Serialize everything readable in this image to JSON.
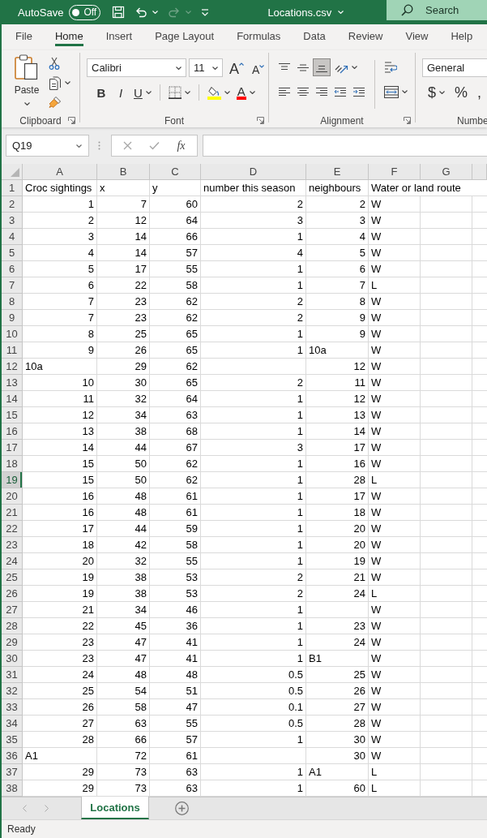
{
  "title_bar": {
    "autosave": {
      "label": "AutoSave",
      "on": false,
      "state": "Off"
    },
    "quick_access": [
      {
        "kind": "save",
        "disabled": false
      },
      {
        "kind": "undo",
        "disabled": false
      },
      {
        "kind": "redo",
        "disabled": true
      },
      {
        "kind": "customize",
        "disabled": false
      }
    ],
    "file_name": "Locations.csv",
    "search": {
      "placeholder": "Search"
    }
  },
  "ribbon_tabs": [
    {
      "label": "File",
      "selected": false
    },
    {
      "label": "Home",
      "selected": true
    },
    {
      "label": "Insert",
      "selected": false
    },
    {
      "label": "Page Layout",
      "selected": false
    },
    {
      "label": "Formulas",
      "selected": false
    },
    {
      "label": "Data",
      "selected": false
    },
    {
      "label": "Review",
      "selected": false
    },
    {
      "label": "View",
      "selected": false
    },
    {
      "label": "Help",
      "selected": false
    }
  ],
  "ribbon": {
    "groups": [
      {
        "kind": "clipboard",
        "label": "Clipboard",
        "paste_label": "Paste"
      },
      {
        "kind": "font",
        "label": "Font",
        "font_name": "Calibri",
        "font_size": "11",
        "grow_label": "A",
        "shrink_label": "A",
        "bold_label": "B",
        "italic_label": "I",
        "underline_label": "U",
        "font_color_label": "A"
      },
      {
        "kind": "alignment",
        "label": "Alignment",
        "vertical_align": [
          {
            "kind": "top",
            "selected": false
          },
          {
            "kind": "middle",
            "selected": false
          },
          {
            "kind": "bottom",
            "selected": true
          }
        ]
      },
      {
        "kind": "number",
        "label": "Numbe",
        "format": "General",
        "currency_label": "$",
        "percent_label": "%",
        "comma_label": ","
      }
    ]
  },
  "formula_bar": {
    "name_box": "Q19",
    "function_label": "fx"
  },
  "sheet": {
    "columns": [
      "A",
      "B",
      "C",
      "D",
      "E",
      "F",
      "G"
    ],
    "rows": [
      {
        "number": "1",
        "selected": false,
        "cells": [
          {
            "text": "Croc sightings",
            "kind": "text"
          },
          {
            "text": "x",
            "kind": "text"
          },
          {
            "text": "y",
            "kind": "text"
          },
          {
            "text": "number this season",
            "kind": "text"
          },
          {
            "text": "neighbours",
            "kind": "text"
          },
          {
            "text": "Water or land route",
            "kind": "text"
          }
        ]
      },
      {
        "number": "2",
        "selected": false,
        "cells": [
          {
            "text": "1",
            "kind": "number"
          },
          {
            "text": "7",
            "kind": "number"
          },
          {
            "text": "60",
            "kind": "number"
          },
          {
            "text": "2",
            "kind": "number"
          },
          {
            "text": "2",
            "kind": "number"
          },
          {
            "text": "W",
            "kind": "text"
          }
        ]
      },
      {
        "number": "3",
        "selected": false,
        "cells": [
          {
            "text": "2",
            "kind": "number"
          },
          {
            "text": "12",
            "kind": "number"
          },
          {
            "text": "64",
            "kind": "number"
          },
          {
            "text": "3",
            "kind": "number"
          },
          {
            "text": "3",
            "kind": "number"
          },
          {
            "text": "W",
            "kind": "text"
          }
        ]
      },
      {
        "number": "4",
        "selected": false,
        "cells": [
          {
            "text": "3",
            "kind": "number"
          },
          {
            "text": "14",
            "kind": "number"
          },
          {
            "text": "66",
            "kind": "number"
          },
          {
            "text": "1",
            "kind": "number"
          },
          {
            "text": "4",
            "kind": "number"
          },
          {
            "text": "W",
            "kind": "text"
          }
        ]
      },
      {
        "number": "5",
        "selected": false,
        "cells": [
          {
            "text": "4",
            "kind": "number"
          },
          {
            "text": "14",
            "kind": "number"
          },
          {
            "text": "57",
            "kind": "number"
          },
          {
            "text": "4",
            "kind": "number"
          },
          {
            "text": "5",
            "kind": "number"
          },
          {
            "text": "W",
            "kind": "text"
          }
        ]
      },
      {
        "number": "6",
        "selected": false,
        "cells": [
          {
            "text": "5",
            "kind": "number"
          },
          {
            "text": "17",
            "kind": "number"
          },
          {
            "text": "55",
            "kind": "number"
          },
          {
            "text": "1",
            "kind": "number"
          },
          {
            "text": "6",
            "kind": "number"
          },
          {
            "text": "W",
            "kind": "text"
          }
        ]
      },
      {
        "number": "7",
        "selected": false,
        "cells": [
          {
            "text": "6",
            "kind": "number"
          },
          {
            "text": "22",
            "kind": "number"
          },
          {
            "text": "58",
            "kind": "number"
          },
          {
            "text": "1",
            "kind": "number"
          },
          {
            "text": "7",
            "kind": "number"
          },
          {
            "text": "L",
            "kind": "text"
          }
        ]
      },
      {
        "number": "8",
        "selected": false,
        "cells": [
          {
            "text": "7",
            "kind": "number"
          },
          {
            "text": "23",
            "kind": "number"
          },
          {
            "text": "62",
            "kind": "number"
          },
          {
            "text": "2",
            "kind": "number"
          },
          {
            "text": "8",
            "kind": "number"
          },
          {
            "text": "W",
            "kind": "text"
          }
        ]
      },
      {
        "number": "9",
        "selected": false,
        "cells": [
          {
            "text": "7",
            "kind": "number"
          },
          {
            "text": "23",
            "kind": "number"
          },
          {
            "text": "62",
            "kind": "number"
          },
          {
            "text": "2",
            "kind": "number"
          },
          {
            "text": "9",
            "kind": "number"
          },
          {
            "text": "W",
            "kind": "text"
          }
        ]
      },
      {
        "number": "10",
        "selected": false,
        "cells": [
          {
            "text": "8",
            "kind": "number"
          },
          {
            "text": "25",
            "kind": "number"
          },
          {
            "text": "65",
            "kind": "number"
          },
          {
            "text": "1",
            "kind": "number"
          },
          {
            "text": "9",
            "kind": "number"
          },
          {
            "text": "W",
            "kind": "text"
          }
        ]
      },
      {
        "number": "11",
        "selected": false,
        "cells": [
          {
            "text": "9",
            "kind": "number"
          },
          {
            "text": "26",
            "kind": "number"
          },
          {
            "text": "65",
            "kind": "number"
          },
          {
            "text": "1",
            "kind": "number"
          },
          {
            "text": "10a",
            "kind": "text"
          },
          {
            "text": "W",
            "kind": "text"
          }
        ]
      },
      {
        "number": "12",
        "selected": false,
        "cells": [
          {
            "text": "10a",
            "kind": "text"
          },
          {
            "text": "29",
            "kind": "number"
          },
          {
            "text": "62",
            "kind": "number"
          },
          null,
          {
            "text": "12",
            "kind": "number"
          },
          {
            "text": "W",
            "kind": "text"
          }
        ]
      },
      {
        "number": "13",
        "selected": false,
        "cells": [
          {
            "text": "10",
            "kind": "number"
          },
          {
            "text": "30",
            "kind": "number"
          },
          {
            "text": "65",
            "kind": "number"
          },
          {
            "text": "2",
            "kind": "number"
          },
          {
            "text": "11",
            "kind": "number"
          },
          {
            "text": "W",
            "kind": "text"
          }
        ]
      },
      {
        "number": "14",
        "selected": false,
        "cells": [
          {
            "text": "11",
            "kind": "number"
          },
          {
            "text": "32",
            "kind": "number"
          },
          {
            "text": "64",
            "kind": "number"
          },
          {
            "text": "1",
            "kind": "number"
          },
          {
            "text": "12",
            "kind": "number"
          },
          {
            "text": "W",
            "kind": "text"
          }
        ]
      },
      {
        "number": "15",
        "selected": false,
        "cells": [
          {
            "text": "12",
            "kind": "number"
          },
          {
            "text": "34",
            "kind": "number"
          },
          {
            "text": "63",
            "kind": "number"
          },
          {
            "text": "1",
            "kind": "number"
          },
          {
            "text": "13",
            "kind": "number"
          },
          {
            "text": "W",
            "kind": "text"
          }
        ]
      },
      {
        "number": "16",
        "selected": false,
        "cells": [
          {
            "text": "13",
            "kind": "number"
          },
          {
            "text": "38",
            "kind": "number"
          },
          {
            "text": "68",
            "kind": "number"
          },
          {
            "text": "1",
            "kind": "number"
          },
          {
            "text": "14",
            "kind": "number"
          },
          {
            "text": "W",
            "kind": "text"
          }
        ]
      },
      {
        "number": "17",
        "selected": false,
        "cells": [
          {
            "text": "14",
            "kind": "number"
          },
          {
            "text": "44",
            "kind": "number"
          },
          {
            "text": "67",
            "kind": "number"
          },
          {
            "text": "3",
            "kind": "number"
          },
          {
            "text": "17",
            "kind": "number"
          },
          {
            "text": "W",
            "kind": "text"
          }
        ]
      },
      {
        "number": "18",
        "selected": false,
        "cells": [
          {
            "text": "15",
            "kind": "number"
          },
          {
            "text": "50",
            "kind": "number"
          },
          {
            "text": "62",
            "kind": "number"
          },
          {
            "text": "1",
            "kind": "number"
          },
          {
            "text": "16",
            "kind": "number"
          },
          {
            "text": "W",
            "kind": "text"
          }
        ]
      },
      {
        "number": "19",
        "selected": true,
        "cells": [
          {
            "text": "15",
            "kind": "number"
          },
          {
            "text": "50",
            "kind": "number"
          },
          {
            "text": "62",
            "kind": "number"
          },
          {
            "text": "1",
            "kind": "number"
          },
          {
            "text": "28",
            "kind": "number"
          },
          {
            "text": "L",
            "kind": "text"
          }
        ]
      },
      {
        "number": "20",
        "selected": false,
        "cells": [
          {
            "text": "16",
            "kind": "number"
          },
          {
            "text": "48",
            "kind": "number"
          },
          {
            "text": "61",
            "kind": "number"
          },
          {
            "text": "1",
            "kind": "number"
          },
          {
            "text": "17",
            "kind": "number"
          },
          {
            "text": "W",
            "kind": "text"
          }
        ]
      },
      {
        "number": "21",
        "selected": false,
        "cells": [
          {
            "text": "16",
            "kind": "number"
          },
          {
            "text": "48",
            "kind": "number"
          },
          {
            "text": "61",
            "kind": "number"
          },
          {
            "text": "1",
            "kind": "number"
          },
          {
            "text": "18",
            "kind": "number"
          },
          {
            "text": "W",
            "kind": "text"
          }
        ]
      },
      {
        "number": "22",
        "selected": false,
        "cells": [
          {
            "text": "17",
            "kind": "number"
          },
          {
            "text": "44",
            "kind": "number"
          },
          {
            "text": "59",
            "kind": "number"
          },
          {
            "text": "1",
            "kind": "number"
          },
          {
            "text": "20",
            "kind": "number"
          },
          {
            "text": "W",
            "kind": "text"
          }
        ]
      },
      {
        "number": "23",
        "selected": false,
        "cells": [
          {
            "text": "18",
            "kind": "number"
          },
          {
            "text": "42",
            "kind": "number"
          },
          {
            "text": "58",
            "kind": "number"
          },
          {
            "text": "1",
            "kind": "number"
          },
          {
            "text": "20",
            "kind": "number"
          },
          {
            "text": "W",
            "kind": "text"
          }
        ]
      },
      {
        "number": "24",
        "selected": false,
        "cells": [
          {
            "text": "20",
            "kind": "number"
          },
          {
            "text": "32",
            "kind": "number"
          },
          {
            "text": "55",
            "kind": "number"
          },
          {
            "text": "1",
            "kind": "number"
          },
          {
            "text": "19",
            "kind": "number"
          },
          {
            "text": "W",
            "kind": "text"
          }
        ]
      },
      {
        "number": "25",
        "selected": false,
        "cells": [
          {
            "text": "19",
            "kind": "number"
          },
          {
            "text": "38",
            "kind": "number"
          },
          {
            "text": "53",
            "kind": "number"
          },
          {
            "text": "2",
            "kind": "number"
          },
          {
            "text": "21",
            "kind": "number"
          },
          {
            "text": "W",
            "kind": "text"
          }
        ]
      },
      {
        "number": "26",
        "selected": false,
        "cells": [
          {
            "text": "19",
            "kind": "number"
          },
          {
            "text": "38",
            "kind": "number"
          },
          {
            "text": "53",
            "kind": "number"
          },
          {
            "text": "2",
            "kind": "number"
          },
          {
            "text": "24",
            "kind": "number"
          },
          {
            "text": "L",
            "kind": "text"
          }
        ]
      },
      {
        "number": "27",
        "selected": false,
        "cells": [
          {
            "text": "21",
            "kind": "number"
          },
          {
            "text": "34",
            "kind": "number"
          },
          {
            "text": "46",
            "kind": "number"
          },
          {
            "text": "1",
            "kind": "number"
          },
          null,
          {
            "text": "W",
            "kind": "text"
          }
        ]
      },
      {
        "number": "28",
        "selected": false,
        "cells": [
          {
            "text": "22",
            "kind": "number"
          },
          {
            "text": "45",
            "kind": "number"
          },
          {
            "text": "36",
            "kind": "number"
          },
          {
            "text": "1",
            "kind": "number"
          },
          {
            "text": "23",
            "kind": "number"
          },
          {
            "text": "W",
            "kind": "text"
          }
        ]
      },
      {
        "number": "29",
        "selected": false,
        "cells": [
          {
            "text": "23",
            "kind": "number"
          },
          {
            "text": "47",
            "kind": "number"
          },
          {
            "text": "41",
            "kind": "number"
          },
          {
            "text": "1",
            "kind": "number"
          },
          {
            "text": "24",
            "kind": "number"
          },
          {
            "text": "W",
            "kind": "text"
          }
        ]
      },
      {
        "number": "30",
        "selected": false,
        "cells": [
          {
            "text": "23",
            "kind": "number"
          },
          {
            "text": "47",
            "kind": "number"
          },
          {
            "text": "41",
            "kind": "number"
          },
          {
            "text": "1",
            "kind": "number"
          },
          {
            "text": "B1",
            "kind": "text"
          },
          {
            "text": "W",
            "kind": "text"
          }
        ]
      },
      {
        "number": "31",
        "selected": false,
        "cells": [
          {
            "text": "24",
            "kind": "number"
          },
          {
            "text": "48",
            "kind": "number"
          },
          {
            "text": "48",
            "kind": "number"
          },
          {
            "text": "0.5",
            "kind": "number"
          },
          {
            "text": "25",
            "kind": "number"
          },
          {
            "text": "W",
            "kind": "text"
          }
        ]
      },
      {
        "number": "32",
        "selected": false,
        "cells": [
          {
            "text": "25",
            "kind": "number"
          },
          {
            "text": "54",
            "kind": "number"
          },
          {
            "text": "51",
            "kind": "number"
          },
          {
            "text": "0.5",
            "kind": "number"
          },
          {
            "text": "26",
            "kind": "number"
          },
          {
            "text": "W",
            "kind": "text"
          }
        ]
      },
      {
        "number": "33",
        "selected": false,
        "cells": [
          {
            "text": "26",
            "kind": "number"
          },
          {
            "text": "58",
            "kind": "number"
          },
          {
            "text": "47",
            "kind": "number"
          },
          {
            "text": "0.1",
            "kind": "number"
          },
          {
            "text": "27",
            "kind": "number"
          },
          {
            "text": "W",
            "kind": "text"
          }
        ]
      },
      {
        "number": "34",
        "selected": false,
        "cells": [
          {
            "text": "27",
            "kind": "number"
          },
          {
            "text": "63",
            "kind": "number"
          },
          {
            "text": "55",
            "kind": "number"
          },
          {
            "text": "0.5",
            "kind": "number"
          },
          {
            "text": "28",
            "kind": "number"
          },
          {
            "text": "W",
            "kind": "text"
          }
        ]
      },
      {
        "number": "35",
        "selected": false,
        "cells": [
          {
            "text": "28",
            "kind": "number"
          },
          {
            "text": "66",
            "kind": "number"
          },
          {
            "text": "57",
            "kind": "number"
          },
          {
            "text": "1",
            "kind": "number"
          },
          {
            "text": "30",
            "kind": "number"
          },
          {
            "text": "W",
            "kind": "text"
          }
        ]
      },
      {
        "number": "36",
        "selected": false,
        "cells": [
          {
            "text": "A1",
            "kind": "text"
          },
          {
            "text": "72",
            "kind": "number"
          },
          {
            "text": "61",
            "kind": "number"
          },
          null,
          {
            "text": "30",
            "kind": "number"
          },
          {
            "text": "W",
            "kind": "text"
          }
        ]
      },
      {
        "number": "37",
        "selected": false,
        "cells": [
          {
            "text": "29",
            "kind": "number"
          },
          {
            "text": "73",
            "kind": "number"
          },
          {
            "text": "63",
            "kind": "number"
          },
          {
            "text": "1",
            "kind": "number"
          },
          {
            "text": "A1",
            "kind": "text"
          },
          {
            "text": "L",
            "kind": "text"
          }
        ]
      },
      {
        "number": "38",
        "selected": false,
        "cells": [
          {
            "text": "29",
            "kind": "number"
          },
          {
            "text": "73",
            "kind": "number"
          },
          {
            "text": "63",
            "kind": "number"
          },
          {
            "text": "1",
            "kind": "number"
          },
          {
            "text": "60",
            "kind": "number"
          },
          {
            "text": "L",
            "kind": "text"
          }
        ]
      }
    ]
  },
  "sheet_tabs": [
    {
      "label": "Locations",
      "selected": true
    }
  ],
  "status_bar": {
    "text": "Ready"
  }
}
